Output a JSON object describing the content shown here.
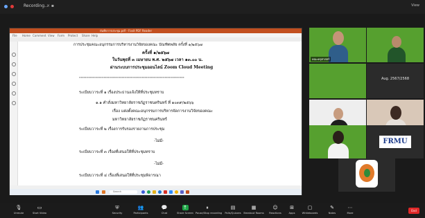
{
  "window": {
    "title": "Recording..."
  },
  "topbar_right": "View",
  "shared_app": {
    "title_bar": "บันทึกการประชุม.pdf - Foxit PDF Reader",
    "menu": [
      "File",
      "Home",
      "Comment",
      "View",
      "Form",
      "Protect",
      "Share",
      "Help"
    ],
    "document": {
      "line1": "การประชุมคณะอนุกรรมการบริหารงานวิจัยของคณะ บัณฑิตพลัย ครั้งที่ ๑/๒๕๖๗",
      "line2": "ครั้งที่  ๑/๒๕๖๗",
      "line3": "ในวันพุธที่  ๓  เมษายน  พ.ศ. ๒๕๖๗ เวลา  ๑๓.๐๐ น.",
      "line4": "ผ่านระบบการประชุมออนไลน์ Zoom Cloud Meeting",
      "separator": "*********************************************************************",
      "agenda1": "ระเบียบวาระที่  ๑  เรื่องประธานแจ้งให้ที่ประชุมทราบ",
      "item11": "๑.๑   คำสั่งมหาวิทยาลัยราชภัฏราชนครินทร์ ที่ ๑๐๓๙/๒๕๖๖",
      "item11b": "เรื่อง  แต่งตั้งคณะอนุกรรมการบริหารจัดการงานวิจัยของคณะ",
      "item11c": "มหาวิทยาลัยราชภัฏราชนครินทร์",
      "agenda2": "ระเบียบวาระที่  ๒  เรื่องการรับรองรายงานการประชุม",
      "none1": "-ไม่มี-",
      "agenda3": "ระเบียบวาระที่  ๓  เรื่องที่เสนอให้ที่ประชุมทราบ",
      "none2": "-ไม่มี-",
      "agenda4": "ระเบียบวาระที่  ๔  เรื่องที่เสนอให้ที่ประชุมพิจารณา"
    },
    "taskbar": {
      "search_placeholder": "Search"
    }
  },
  "gallery": {
    "tiles": [
      {
        "label": "คณะครุศาสตร์"
      },
      {
        "label": ""
      },
      {
        "label": ""
      },
      {
        "label": "",
        "center_text": "Aug. 2567/2568"
      },
      {
        "label": ""
      },
      {
        "label": ""
      },
      {
        "label": ""
      },
      {
        "label": "",
        "logo_text": "FRMU"
      },
      {
        "label": ""
      },
      {
        "label": ""
      }
    ]
  },
  "toolbar": {
    "buttons": [
      {
        "label": "Unmute",
        "icon": "microphone-icon"
      },
      {
        "label": "Start Video",
        "icon": "video-icon"
      },
      {
        "label": "Security",
        "icon": "shield-icon"
      },
      {
        "label": "Participants",
        "icon": "participants-icon"
      },
      {
        "label": "Chat",
        "icon": "chat-icon"
      },
      {
        "label": "Share Screen",
        "icon": "share-screen-icon"
      },
      {
        "label": "Pause/Stop recording",
        "icon": "record-icon"
      },
      {
        "label": "Polls/Quizzes",
        "icon": "polls-icon"
      },
      {
        "label": "Breakout Rooms",
        "icon": "breakout-icon"
      },
      {
        "label": "Reactions",
        "icon": "reactions-icon"
      },
      {
        "label": "Apps",
        "icon": "apps-icon"
      },
      {
        "label": "Whiteboards",
        "icon": "whiteboard-icon"
      },
      {
        "label": "Notes",
        "icon": "notes-icon"
      },
      {
        "label": "More",
        "icon": "more-icon"
      }
    ],
    "end_label": "End"
  }
}
